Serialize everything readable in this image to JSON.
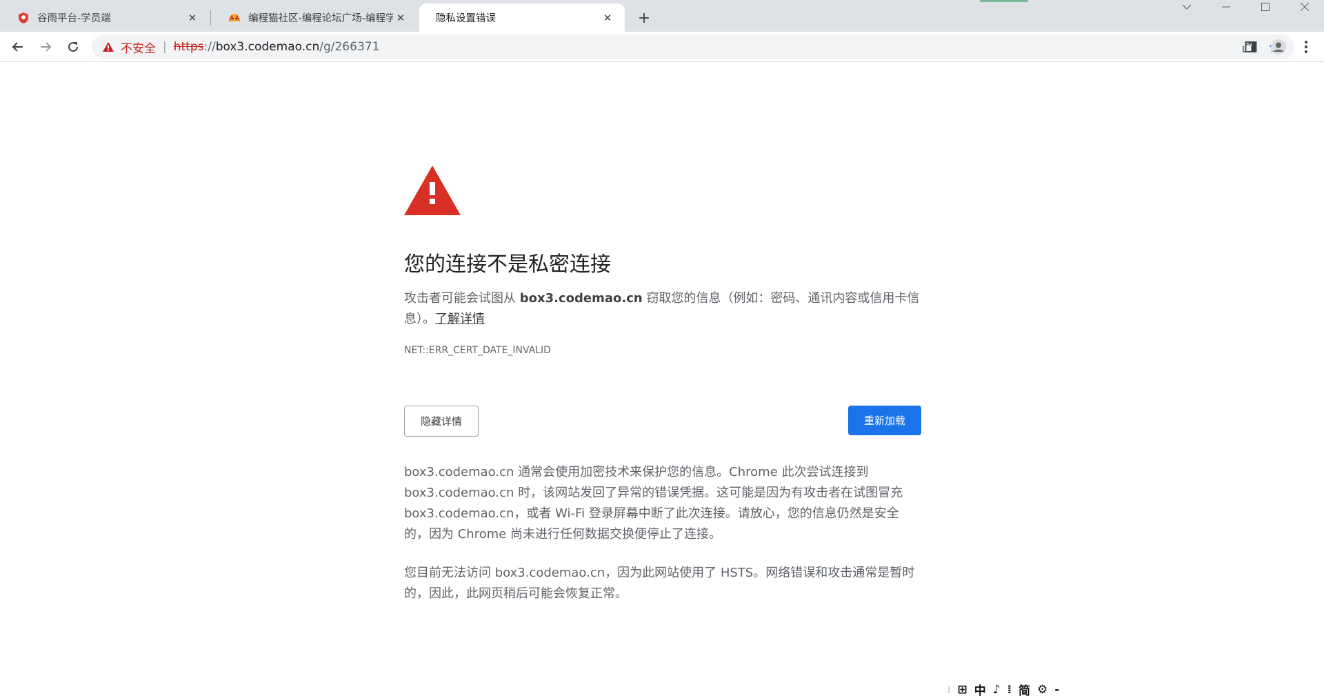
{
  "browser": {
    "tabs": [
      {
        "title": "谷雨平台-学员端",
        "icon": "gu-yu-logo-icon",
        "active": false
      },
      {
        "title": "编程猫社区-编程论坛广场-编程学",
        "icon": "codemao-logo-icon",
        "active": false
      },
      {
        "title": "隐私设置错误",
        "icon": "none",
        "active": true
      }
    ],
    "close_symbol": "✕",
    "new_tab_symbol": "+",
    "omnibox": {
      "security_label": "不安全",
      "divider": "|",
      "scheme": "https",
      "rest": "://",
      "host": "box3.codemao.cn",
      "path": "/g/266371"
    }
  },
  "page": {
    "heading": "您的连接不是私密连接",
    "intro_before": "攻击者可能会试图从 ",
    "intro_host": "box3.codemao.cn",
    "intro_after": " 窃取您的信息（例如：密码、通讯内容或信用卡信息）。",
    "learn_more": "了解详情",
    "error_code": "NET::ERR_CERT_DATE_INVALID",
    "hide_details_button": "隐藏详情",
    "reload_button": "重新加载",
    "details_para1": "box3.codemao.cn 通常会使用加密技术来保护您的信息。Chrome 此次尝试连接到 box3.codemao.cn 时，该网站发回了异常的错误凭据。这可能是因为有攻击者在试图冒充 box3.codemao.cn，或者 Wi-Fi 登录屏幕中断了此次连接。请放心，您的信息仍然是安全的，因为 Chrome 尚未进行任何数据交换便停止了连接。",
    "details_para2": "您目前无法访问 box3.codemao.cn，因为此网站使用了 HSTS。网络错误和攻击通常是暂时的，因此，此网页稍后可能会恢复正常。"
  },
  "ime_toolbar": {
    "items": [
      "⁝",
      "⊞",
      "中",
      "♪",
      "⁞",
      "简",
      "⚙",
      "-"
    ]
  },
  "colors": {
    "tabstrip_bg": "#dee1e6",
    "warning_red": "#d93025",
    "insecure_red": "#c5221f",
    "reload_blue": "#1a73e8",
    "star_blue": "#1a73e8"
  }
}
